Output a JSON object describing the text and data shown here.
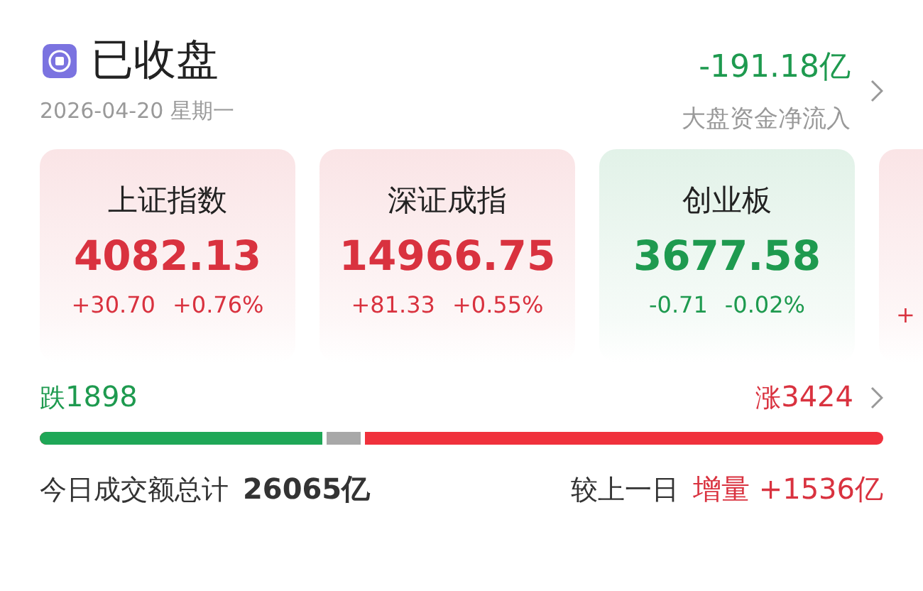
{
  "header": {
    "status": "已收盘",
    "date": "2026-04-20 星期一",
    "net_flow": "-191.18亿",
    "net_flow_label": "大盘资金净流入"
  },
  "indices": [
    {
      "name": "上证指数",
      "value": "4082.13",
      "change": "+30.70",
      "percent": "+0.76%",
      "color": "#d9323f"
    },
    {
      "name": "深证成指",
      "value": "14966.75",
      "change": "+81.33",
      "percent": "+0.55%",
      "color": "#d9323f"
    },
    {
      "name": "创业板",
      "value": "3677.58",
      "change": "-0.71",
      "percent": "-0.02%",
      "color": "#1e9a4f"
    },
    {
      "change": "+",
      "color": "#d9323f"
    }
  ],
  "breadth": {
    "down_label": "跌",
    "down_count": "1898",
    "up_label": "涨",
    "up_count": "3424",
    "level": 0.385
  },
  "turnover": {
    "label": "今日成交额总计",
    "total": "26065亿",
    "compare_label": "较上一日",
    "change_label": "增量",
    "change": "+1536亿"
  }
}
